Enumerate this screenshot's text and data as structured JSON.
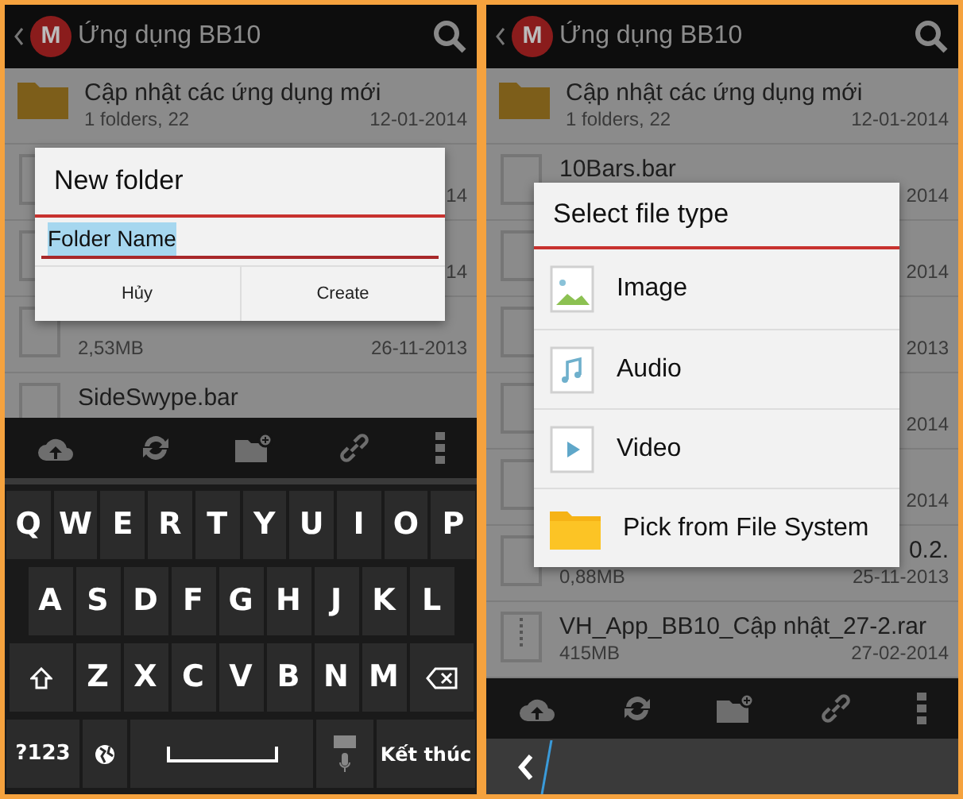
{
  "screens": [
    {
      "kind": "new_folder",
      "header": {
        "logo": "M",
        "title": "Ứng dụng BB10"
      },
      "files": [
        {
          "kind": "folder",
          "name": "Cập nhật các ứng dụng mới",
          "info": "1 folders, 22",
          "date": "12-01-2014"
        },
        {
          "kind": "file",
          "date": "14"
        },
        {
          "kind": "file",
          "date": "14"
        },
        {
          "kind": "file",
          "info": "2,53MB",
          "date": "26-11-2013"
        },
        {
          "kind": "file",
          "name": "SideSwype.bar"
        }
      ],
      "dialog": {
        "title": "New folder",
        "field": {
          "value": "Folder Name",
          "highlighted": true
        },
        "buttons": [
          "Hủy",
          "Create"
        ]
      },
      "keyboard": {
        "rows": [
          [
            "Q",
            "W",
            "E",
            "R",
            "T",
            "Y",
            "U",
            "I",
            "O",
            "P"
          ],
          [
            "A",
            "S",
            "D",
            "F",
            "G",
            "H",
            "J",
            "K",
            "L"
          ],
          [
            "Z",
            "X",
            "C",
            "V",
            "B",
            "N",
            "M"
          ]
        ],
        "symbols_key": "?123",
        "enter_key": "Kết thúc"
      }
    },
    {
      "kind": "file_type",
      "header": {
        "logo": "M",
        "title": "Ứng dụng BB10"
      },
      "files": [
        {
          "kind": "folder",
          "name": "Cập nhật các ứng dụng mới",
          "info": "1 folders, 22",
          "date": "12-01-2014"
        },
        {
          "kind": "file",
          "name": "10Bars.bar",
          "date": "2014"
        },
        {
          "kind": "file",
          "date": "2014"
        },
        {
          "kind": "file",
          "date": "2013"
        },
        {
          "kind": "file",
          "date": "2014"
        },
        {
          "kind": "file",
          "date": "2014"
        },
        {
          "kind": "file",
          "name_tail": "0.2.",
          "info": "0,88MB",
          "date": "25-11-2013"
        },
        {
          "kind": "archive",
          "name": "VH_App_BB10_Cập nhật_27-2.rar",
          "info": "415MB",
          "date": "27-02-2014"
        }
      ],
      "dialog": {
        "title": "Select file type",
        "options": [
          {
            "kind": "image",
            "label": "Image"
          },
          {
            "kind": "audio",
            "label": "Audio"
          },
          {
            "kind": "video",
            "label": "Video"
          },
          {
            "kind": "folder",
            "label": "Pick from File System"
          }
        ]
      }
    }
  ]
}
